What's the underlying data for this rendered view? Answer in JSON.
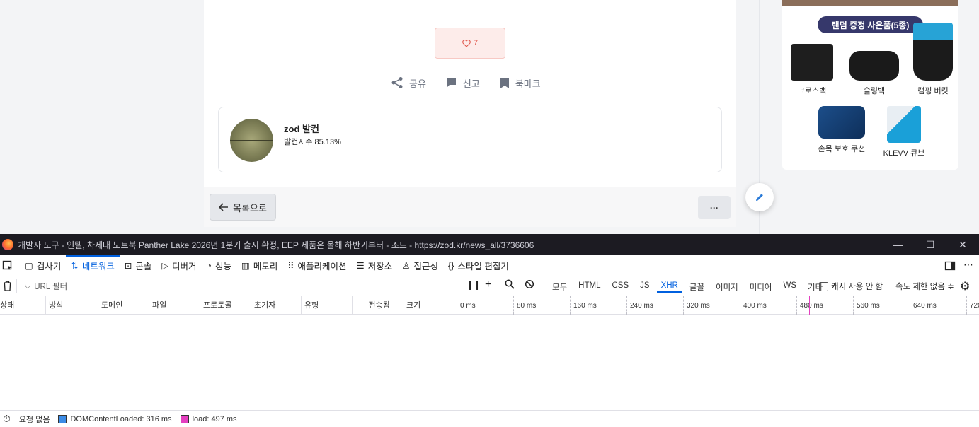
{
  "article": {
    "like_count": "7",
    "actions": {
      "share": "공유",
      "report": "신고",
      "bookmark": "북마크"
    },
    "author": {
      "name": "zod 발컨",
      "score": "발컨지수 85.13%"
    },
    "list_button": "목록으로",
    "more_button": "···"
  },
  "ad": {
    "pill": "랜덤 증정 사은품(5종)",
    "items": [
      "크로스백",
      "슬링백",
      "캠핑 버킷",
      "손목 보호 쿠션",
      "KLEVV 큐브"
    ]
  },
  "devtools": {
    "title": "개발자 도구 - 인텔, 차세대 노트북 Panther Lake 2026년 1분기 출시 확정, EEP 제품은 올해 하반기부터 - 조드 - https://zod.kr/news_all/3736606",
    "tabs": [
      "검사기",
      "네트워크",
      "콘솔",
      "디버거",
      "성능",
      "메모리",
      "애플리케이션",
      "저장소",
      "접근성",
      "스타일 편집기"
    ],
    "filter_placeholder": "URL 필터",
    "filter_types": [
      "모두",
      "HTML",
      "CSS",
      "JS",
      "XHR",
      "글꼴",
      "이미지",
      "미디어",
      "WS",
      "기타"
    ],
    "active_filter": "XHR",
    "cache_label": "캐시 사용 안 함",
    "throttle_label": "속도 제한 없음 ≑",
    "columns": [
      "상태",
      "방식",
      "도메인",
      "파일",
      "프로토콜",
      "초기자",
      "유형",
      "전송됨",
      "크기"
    ],
    "ticks": [
      "0 ms",
      "80 ms",
      "160 ms",
      "240 ms",
      "320 ms",
      "400 ms",
      "480 ms",
      "560 ms",
      "640 ms",
      "720"
    ],
    "status": {
      "requests": "요청 없음",
      "dom_content_loaded": "DOMContentLoaded: 316 ms",
      "load": "load: 497 ms"
    },
    "colors": {
      "dom": "#3c8ce6",
      "load": "#e43fc0",
      "accent": "#0060df"
    }
  }
}
